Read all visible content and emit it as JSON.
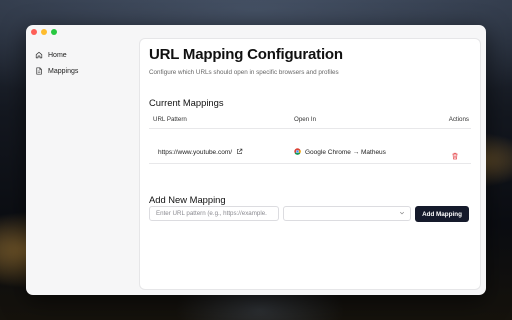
{
  "sidebar": {
    "items": [
      {
        "label": "Home",
        "icon": "home-icon"
      },
      {
        "label": "Mappings",
        "icon": "file-icon"
      }
    ]
  },
  "main": {
    "title": "URL Mapping Configuration",
    "subtitle": "Configure which URLs should open in specific browsers and profiles",
    "current_section": "Current Mappings",
    "columns": [
      "URL Pattern",
      "Open In",
      "Actions"
    ],
    "mappings": [
      {
        "url": "https://www.youtube.com/",
        "open_in": "Google Chrome → Matheus"
      }
    ],
    "add_section": "Add New Mapping",
    "url_input": {
      "placeholder": "Enter URL pattern (e.g., https://example.",
      "value": ""
    },
    "browser_select": {
      "value": ""
    },
    "add_button": "Add Mapping"
  },
  "colors": {
    "accent": "#151a2b",
    "delete": "#e5484d",
    "background": "#f6f6f7"
  }
}
